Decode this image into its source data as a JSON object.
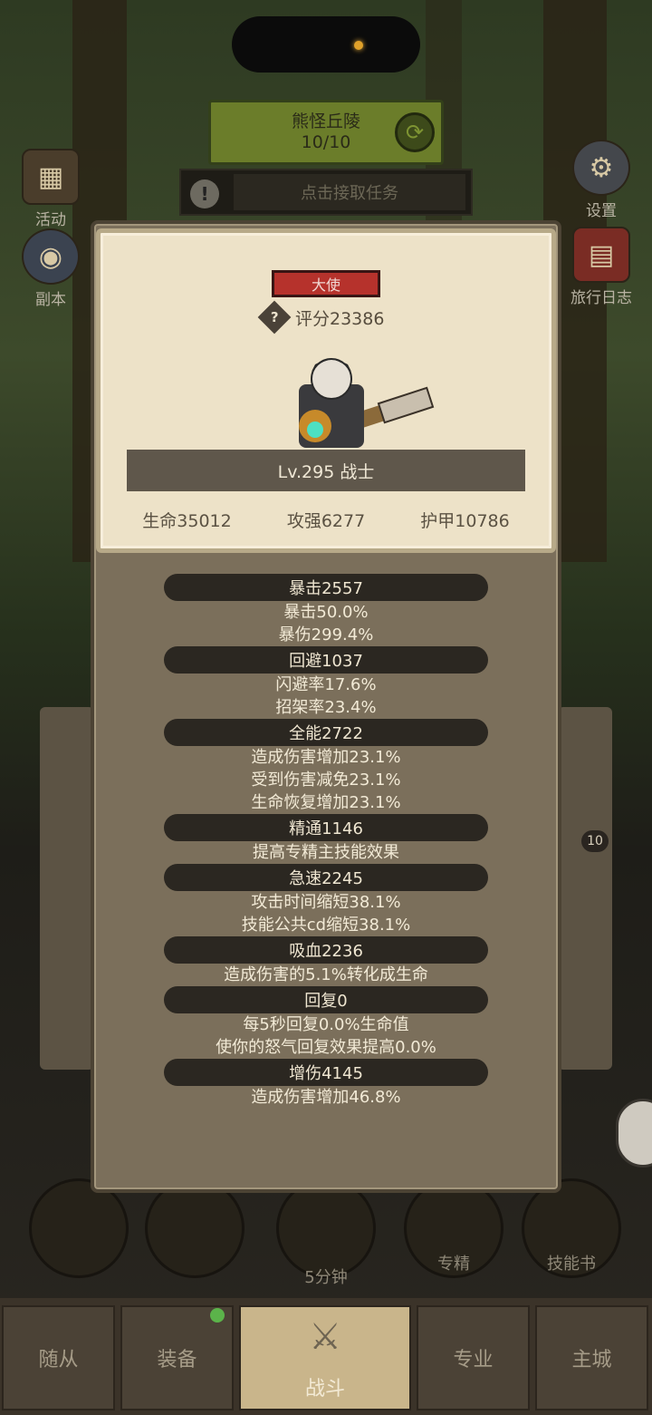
{
  "top": {
    "stage_title": "熊怪丘陵",
    "stage_progress": "10/10",
    "task_text": "点击接取任务"
  },
  "side_left": {
    "activity": "活动",
    "dungeon": "副本"
  },
  "side_right": {
    "settings": "设置",
    "travel_log": "旅行日志"
  },
  "profile": {
    "tag": "大使",
    "score": "评分23386",
    "level_class": "Lv.295 战士",
    "hp": "生命35012",
    "attack": "攻强6277",
    "armor": "护甲10786"
  },
  "stats": [
    {
      "header": "暴击2557",
      "lines": [
        "暴击50.0%",
        "暴伤299.4%"
      ]
    },
    {
      "header": "回避1037",
      "lines": [
        "闪避率17.6%",
        "招架率23.4%"
      ]
    },
    {
      "header": "全能2722",
      "lines": [
        "造成伤害增加23.1%",
        "受到伤害减免23.1%",
        "生命恢复增加23.1%"
      ]
    },
    {
      "header": "精通1146",
      "lines": [
        "提高专精主技能效果"
      ]
    },
    {
      "header": "急速2245",
      "lines": [
        "攻击时间缩短38.1%",
        "技能公共cd缩短38.1%"
      ]
    },
    {
      "header": "吸血2236",
      "lines": [
        "造成伤害的5.1%转化成生命"
      ]
    },
    {
      "header": "回复0",
      "lines": [
        "每5秒回复0.0%生命值",
        "使你的怒气回复效果提高0.0%"
      ]
    },
    {
      "header": "增伤4145",
      "lines": [
        "造成伤害增加46.8%"
      ]
    }
  ],
  "bottom_buttons": {
    "chest_timer": "5分钟",
    "specialization": "专精",
    "skill_book": "技能书"
  },
  "tabs": [
    "随从",
    "装备",
    "战斗",
    "专业",
    "主城"
  ],
  "badge_count": "10"
}
